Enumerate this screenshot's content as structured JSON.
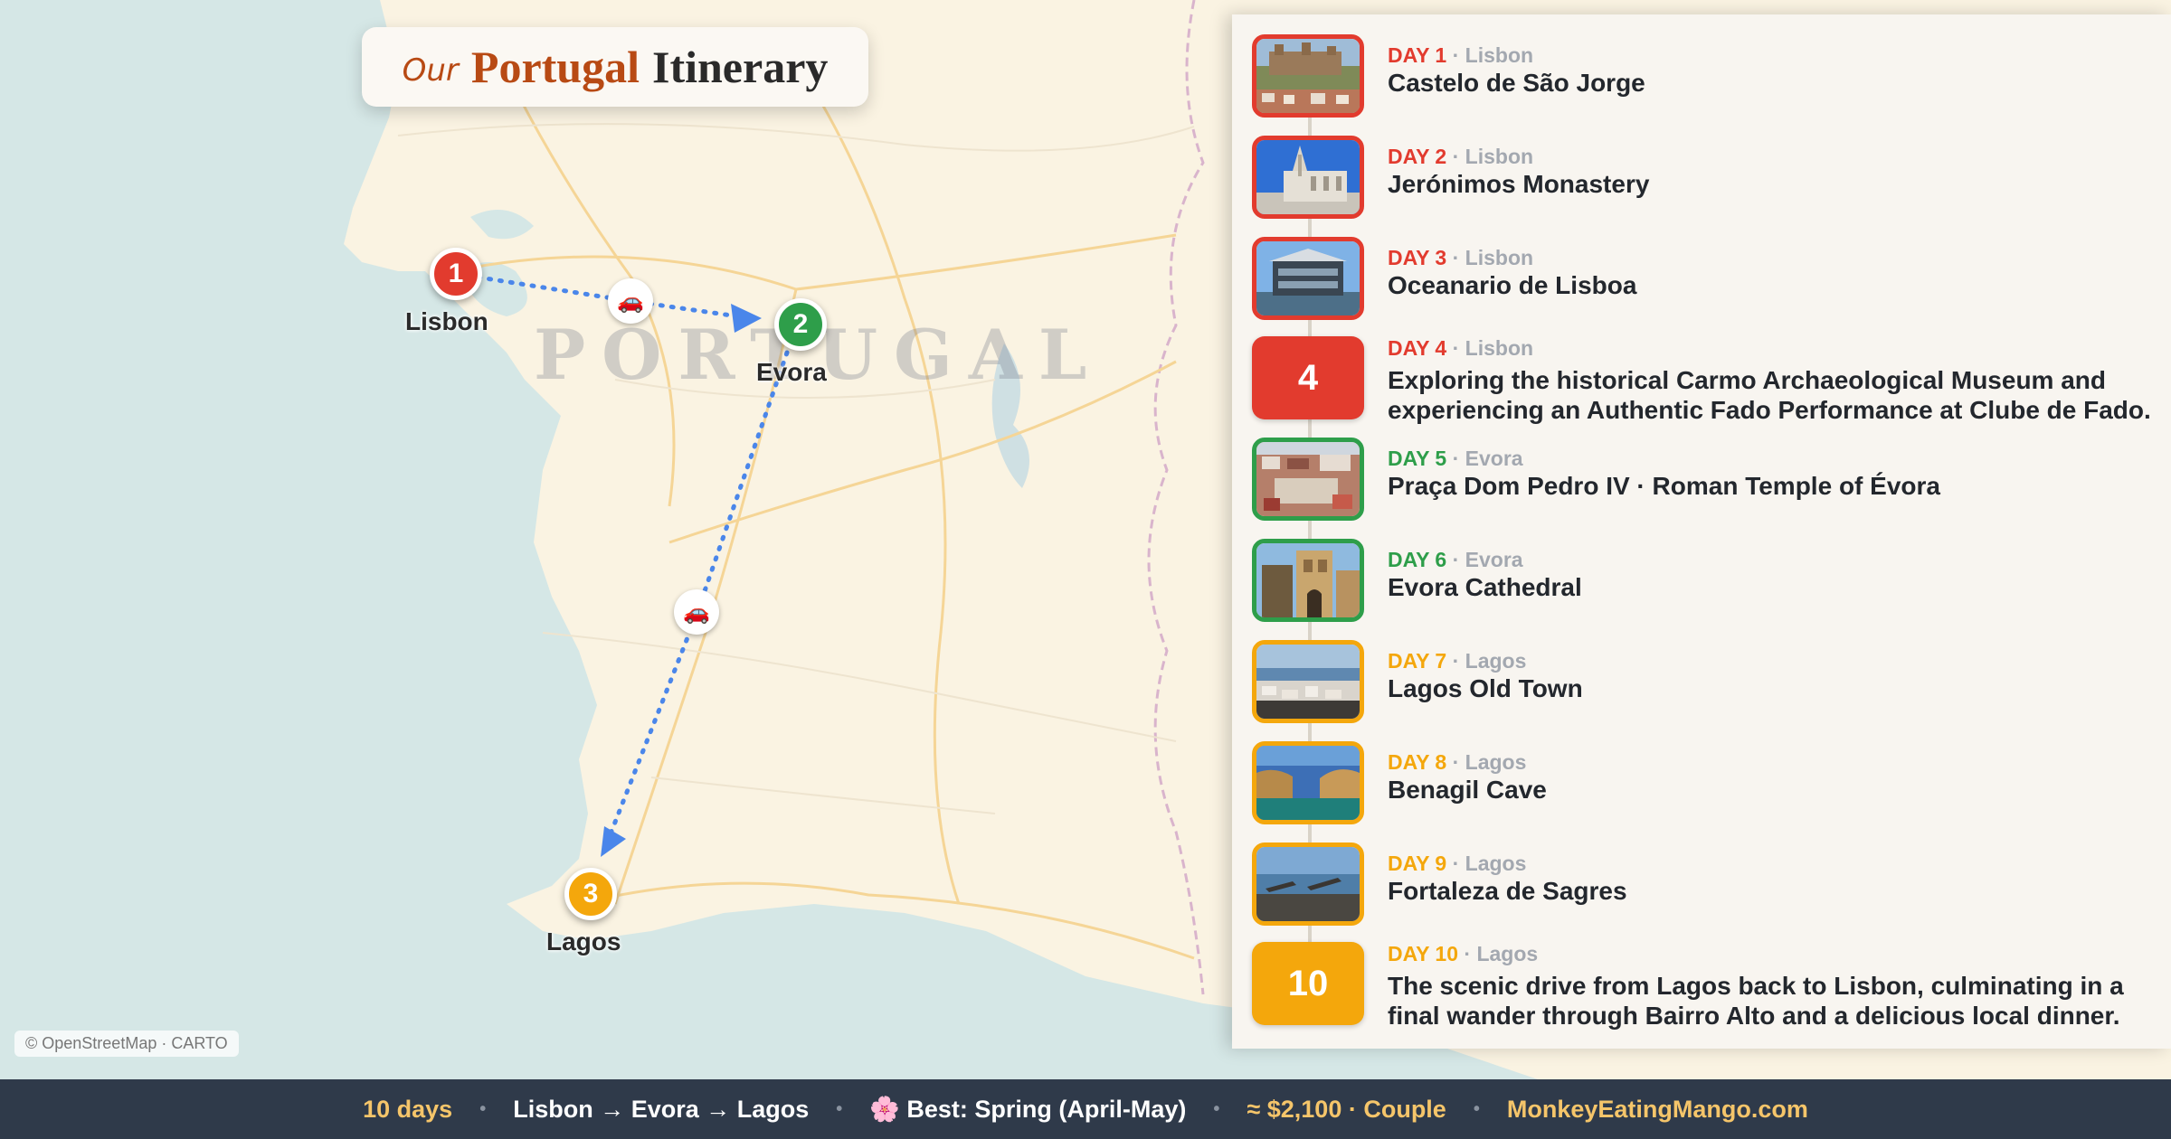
{
  "title": {
    "prefix": "Our",
    "highlight": "Portugal",
    "rest": "Itinerary"
  },
  "map": {
    "country_label": "PORTUGAL",
    "attribution": "© OpenStreetMap · CARTO",
    "stops": [
      {
        "number": "1",
        "city": "Lisbon",
        "color": "#e23b2e"
      },
      {
        "number": "2",
        "city": "Evora",
        "color": "#2e9e4a"
      },
      {
        "number": "3",
        "city": "Lagos",
        "color": "#f4a70c"
      }
    ],
    "route_color": "#4a86ea",
    "transport_icons": [
      "car-icon",
      "car-icon"
    ]
  },
  "days": [
    {
      "day": "DAY 1",
      "location": "Lisbon",
      "title": "Castelo de São Jorge",
      "color": "#e23b2e"
    },
    {
      "day": "DAY 2",
      "location": "Lisbon",
      "title": "Jerónimos Monastery",
      "color": "#e23b2e"
    },
    {
      "day": "DAY 3",
      "location": "Lisbon",
      "title": "Oceanario de Lisboa",
      "color": "#e23b2e"
    },
    {
      "day": "DAY 4",
      "location": "Lisbon",
      "badge": "4",
      "title": "Exploring the historical Carmo Archaeological Museum and experiencing an Authentic Fado Performance at Clube de Fado.",
      "color": "#e23b2e"
    },
    {
      "day": "DAY 5",
      "location": "Evora",
      "title": "Praça Dom Pedro IV · Roman Temple of Évora",
      "color": "#2e9e4a"
    },
    {
      "day": "DAY 6",
      "location": "Evora",
      "title": "Evora Cathedral",
      "color": "#2e9e4a"
    },
    {
      "day": "DAY 7",
      "location": "Lagos",
      "title": "Lagos Old Town",
      "color": "#f4a70c"
    },
    {
      "day": "DAY 8",
      "location": "Lagos",
      "title": "Benagil Cave",
      "color": "#f4a70c"
    },
    {
      "day": "DAY 9",
      "location": "Lagos",
      "title": "Fortaleza de Sagres",
      "color": "#f4a70c"
    },
    {
      "day": "DAY 10",
      "location": "Lagos",
      "badge": "10",
      "title": "The scenic drive from Lagos back to Lisbon, culminating in a final wander through Bairro Alto and a delicious local dinner.",
      "color": "#f4a70c"
    }
  ],
  "footer": {
    "duration": "10 days",
    "route": "Lisbon → Evora → Lagos",
    "season_icon": "🌸",
    "season": "Best: Spring (April-May)",
    "budget": "≈ $2,100 · Couple",
    "site": "MonkeyEatingMango.com",
    "separator": "•"
  }
}
